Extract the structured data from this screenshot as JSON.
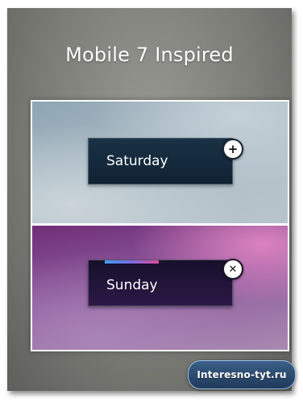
{
  "header": {
    "title": "Mobile 7 Inspired"
  },
  "tiles": [
    {
      "label": "Saturday",
      "action_icon": "plus-icon",
      "action_glyph": "+",
      "accent": null
    },
    {
      "label": "Sunday",
      "action_icon": "close-icon",
      "action_glyph": "✕",
      "accent": [
        "#3fa0e8",
        "#e04a9c"
      ]
    }
  ],
  "watermark": {
    "text": "Interesno-tyt.ru"
  },
  "colors": {
    "frame_background": "#7d7d78",
    "top_panel": "#a9bac4",
    "bottom_panel": "#8f5d9f",
    "saturday_tile": "#132a3c",
    "sunday_tile": "#21143a"
  }
}
